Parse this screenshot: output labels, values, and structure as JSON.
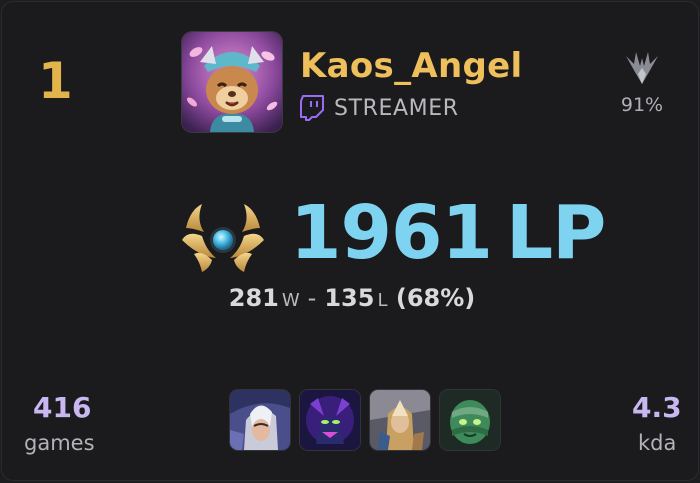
{
  "player": {
    "rank_position": "1",
    "name": "Kaos_Angel",
    "badge_label": "STREAMER",
    "tier_percent": "91%"
  },
  "league": {
    "lp_value": "1961",
    "lp_unit": "LP",
    "wins": "281",
    "wins_unit": "W",
    "separator": "-",
    "losses": "135",
    "losses_unit": "L",
    "win_rate": "(68%)"
  },
  "stats": {
    "games_value": "416",
    "games_label": "games",
    "kda_value": "4.3",
    "kda_label": "kda"
  },
  "champions": [
    {
      "icon": "champion-portrait-armored-silver"
    },
    {
      "icon": "champion-portrait-violet-void"
    },
    {
      "icon": "champion-portrait-golden-warrior"
    },
    {
      "icon": "champion-portrait-green-mummy"
    }
  ],
  "colors": {
    "rank_gold": "#e3b44a",
    "name_gold": "#eebf5a",
    "lp_blue": "#7ed4f0",
    "stat_violet": "#c9b7f2",
    "twitch_purple": "#9b6cf3"
  }
}
